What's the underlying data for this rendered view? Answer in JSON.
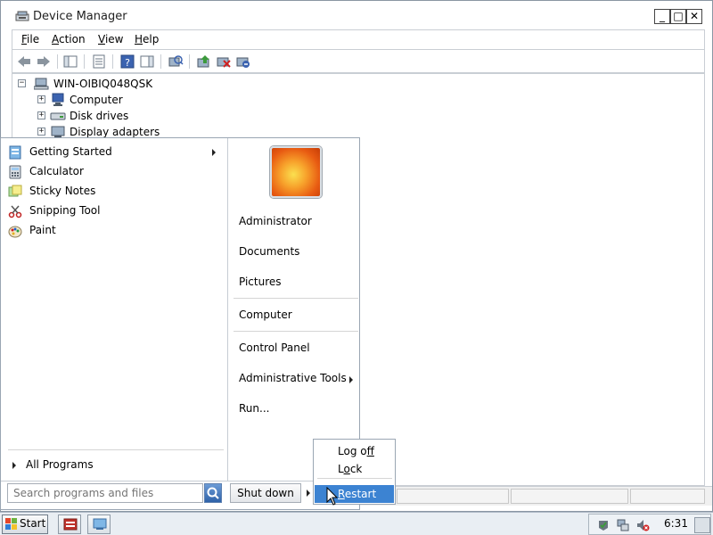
{
  "window": {
    "title": "Device Manager",
    "minimize_glyph": "_",
    "maximize_glyph": "□",
    "close_glyph": "✕"
  },
  "menubar": {
    "items": [
      {
        "acc": "F",
        "rest": "ile"
      },
      {
        "acc": "A",
        "rest": "ction"
      },
      {
        "acc": "V",
        "rest": "iew"
      },
      {
        "acc": "H",
        "rest": "elp"
      }
    ]
  },
  "toolbar": {
    "icons": [
      "back-icon",
      "forward-icon",
      "show-hide-console-tree-icon",
      "properties-icon",
      "help-icon",
      "action-pane-icon",
      "scan-hardware-icon",
      "update-driver-icon",
      "disable-device-icon",
      "uninstall-device-icon"
    ]
  },
  "tree": {
    "root": {
      "label": "WIN-OIBIQ048QSK",
      "expander": "−"
    },
    "children": [
      {
        "label": "Computer",
        "expander": "+"
      },
      {
        "label": "Disk drives",
        "expander": "+"
      },
      {
        "label": "Display adapters",
        "expander": "+"
      }
    ]
  },
  "start_menu": {
    "programs": [
      {
        "label": "Getting Started",
        "has_submenu": true,
        "icon": "getting-started-icon"
      },
      {
        "label": "Calculator",
        "has_submenu": false,
        "icon": "calculator-icon"
      },
      {
        "label": "Sticky Notes",
        "has_submenu": false,
        "icon": "sticky-notes-icon"
      },
      {
        "label": "Snipping Tool",
        "has_submenu": false,
        "icon": "snipping-tool-icon"
      },
      {
        "label": "Paint",
        "has_submenu": false,
        "icon": "paint-icon"
      }
    ],
    "all_programs": "All Programs",
    "right_links": {
      "administrator": "Administrator",
      "documents": "Documents",
      "pictures": "Pictures",
      "computer": "Computer",
      "control_panel": "Control Panel",
      "administrative_tools": "Administrative Tools",
      "run": "Run..."
    },
    "search_placeholder": "Search programs and files",
    "shutdown_label": "Shut down"
  },
  "shutdown_menu": {
    "log_off": {
      "acc": "",
      "pre": "Log o",
      "acc_char": "f",
      "post": "f"
    },
    "lock": {
      "pre": "L",
      "acc_char": "o",
      "post": "ck"
    },
    "restart": {
      "pre": "",
      "acc_char": "R",
      "post": "estart"
    }
  },
  "taskbar": {
    "start_label": "Start",
    "clock": "6:31"
  },
  "colors": {
    "highlight": "#3c83d2",
    "accent_blue": "#2e62a8"
  }
}
